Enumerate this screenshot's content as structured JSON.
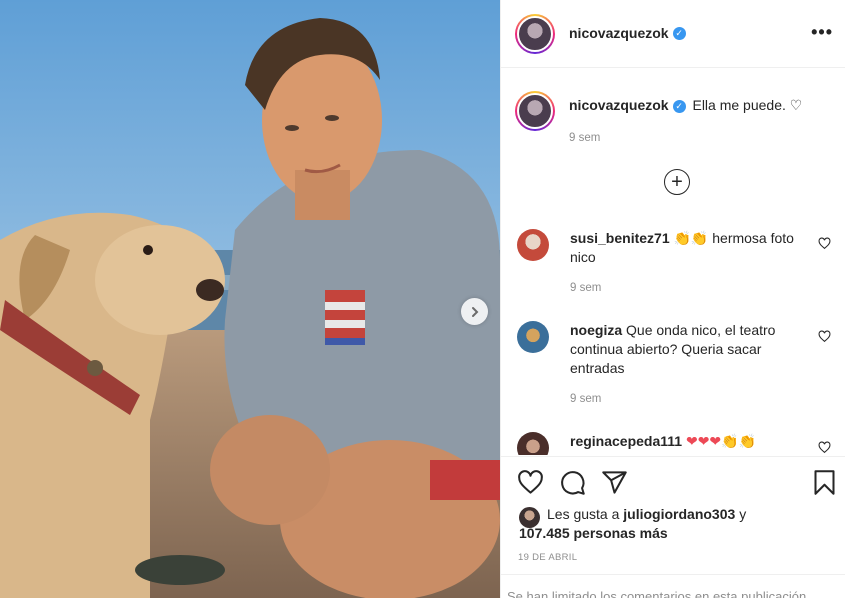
{
  "post": {
    "username": "nicovazquezok",
    "verified_mark": "✓",
    "caption": "Ella me puede. ♡",
    "caption_time": "9 sem"
  },
  "comments": [
    {
      "username": "susi_benitez71",
      "text": "👏👏 hermosa foto nico",
      "time": "9 sem"
    },
    {
      "username": "noegiza",
      "text": "Que onda nico, el teatro continua abierto? Queria sacar entradas",
      "time": "9 sem"
    },
    {
      "username": "reginacepeda111",
      "text": "❤❤❤👏👏",
      "time": ""
    }
  ],
  "likes": {
    "prefix": "Les gusta a",
    "user": "juliogiordano303",
    "suffix": "y",
    "count_text": "107.485 personas más"
  },
  "date": "19 DE ABRIL",
  "limited_notice": "Se han limitado los comentarios en esta publicación",
  "icons": {
    "more": "more-icon",
    "load_more": "plus-circle-icon",
    "like": "heart-icon",
    "comment": "comment-icon",
    "share": "share-icon",
    "save": "bookmark-icon",
    "next": "chevron-right-icon"
  },
  "colors": {
    "verified": "#3897f0",
    "like_red": "#ed4956",
    "muted": "#8e8e8e"
  }
}
